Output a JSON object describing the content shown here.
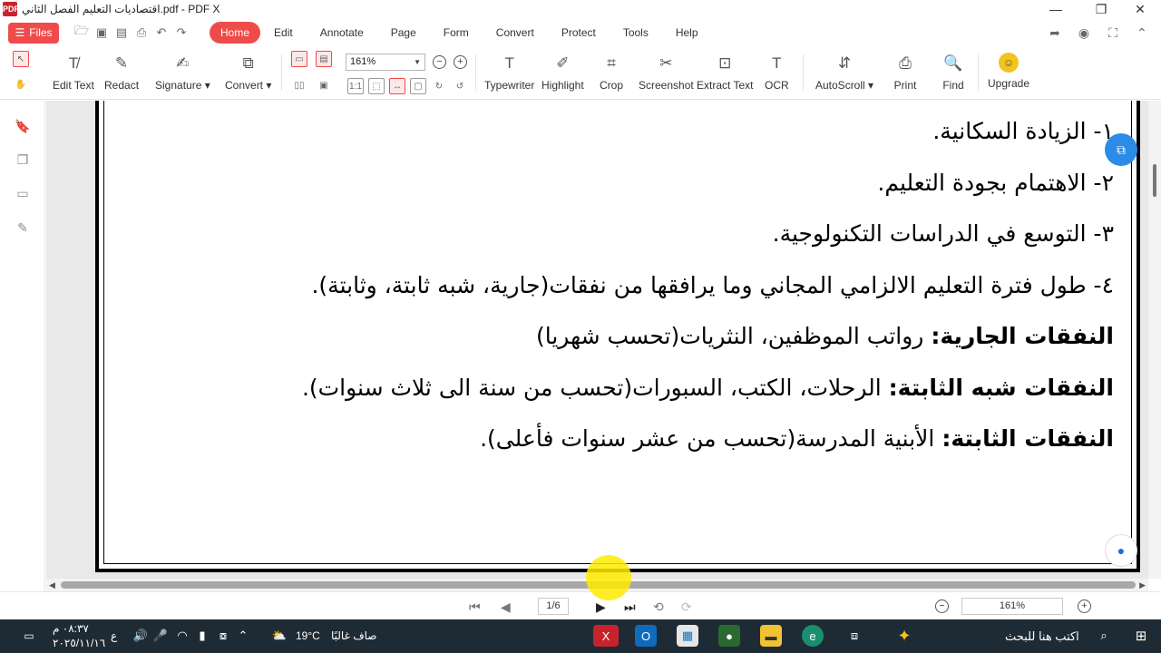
{
  "window": {
    "title": "اقتصاديات التعليم الفصل الثاني.pdf - PDF X",
    "app_logo": "PDF"
  },
  "menubar": {
    "files_label": "Files",
    "tabs": [
      "Home",
      "Edit",
      "Annotate",
      "Page",
      "Form",
      "Convert",
      "Protect",
      "Tools",
      "Help"
    ],
    "active_tab": "Home"
  },
  "ribbon": {
    "tools": [
      {
        "label": "Edit Text",
        "icon": "edit-text-icon"
      },
      {
        "label": "Redact",
        "icon": "redact-icon"
      },
      {
        "label": "Signature ▾",
        "icon": "signature-icon"
      },
      {
        "label": "Convert ▾",
        "icon": "convert-icon"
      },
      {
        "label": "Typewriter",
        "icon": "typewriter-icon"
      },
      {
        "label": "Highlight",
        "icon": "highlight-icon"
      },
      {
        "label": "Crop",
        "icon": "crop-icon"
      },
      {
        "label": "Screenshot",
        "icon": "screenshot-icon"
      },
      {
        "label": "Extract Text",
        "icon": "extract-text-icon"
      },
      {
        "label": "OCR",
        "icon": "ocr-icon"
      },
      {
        "label": "AutoScroll ▾",
        "icon": "autoscroll-icon"
      },
      {
        "label": "Print",
        "icon": "print-icon"
      },
      {
        "label": "Find",
        "icon": "find-icon"
      },
      {
        "label": "Upgrade",
        "icon": "upgrade-icon"
      }
    ],
    "zoom_value": "161%"
  },
  "document": {
    "lines": [
      {
        "bold": "",
        "text": "١- الزيادة السكانية."
      },
      {
        "bold": "",
        "text": "٢- الاهتمام بجودة التعليم."
      },
      {
        "bold": "",
        "text": "٣- التوسع في الدراسات التكنولوجية."
      },
      {
        "bold": "",
        "text": "٤- طول فترة التعليم الالزامي المجاني وما يرافقها من نفقات(جارية، شبه ثابتة، وثابتة)."
      },
      {
        "bold": "النفقات الجارية:",
        "text": " رواتب الموظفين، النثريات(تحسب شهريا)"
      },
      {
        "bold": "النفقات شبه الثابتة:",
        "text": " الرحلات، الكتب، السبورات(تحسب من سنة الى ثلاث سنوات)."
      },
      {
        "bold": "النفقات الثابتة:",
        "text": " الأبنية المدرسة(تحسب من عشر سنوات فأعلى)."
      }
    ]
  },
  "statusbar": {
    "page_indicator": "1/6",
    "zoom_value": "161%"
  },
  "taskbar": {
    "search_placeholder": "اكتب هنا للبحث",
    "weather_temp": "19°C",
    "weather_desc": "صاف غالبًا",
    "time": "٠٨:٣٧ م",
    "date": "٢٠٢٥/١١/١٦",
    "lang": "ع"
  }
}
